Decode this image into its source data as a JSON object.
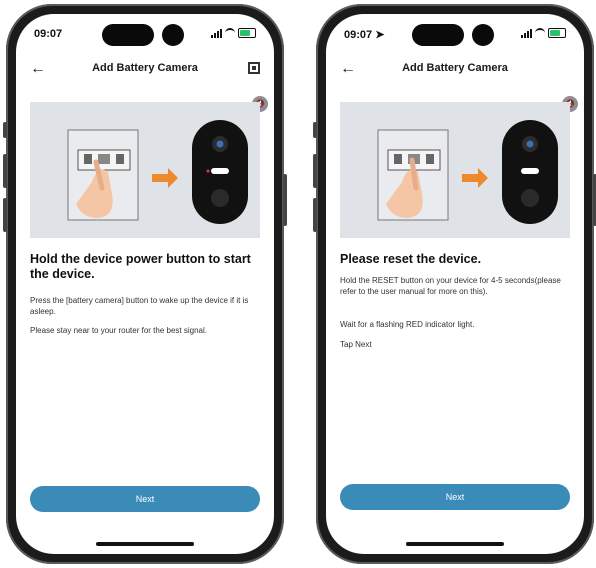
{
  "phones": [
    {
      "status_time": "09:07",
      "nav_title": "Add Battery Camera",
      "heading": "Hold the device power button to start the device.",
      "paragraphs": [
        "Press the [battery camera] button to wake up the device if it is asleep.",
        "Please stay near to your router for the best signal."
      ],
      "next_label": "Next"
    },
    {
      "status_time": "09:07",
      "nav_title": "Add Battery Camera",
      "heading": "Please reset the device.",
      "paragraphs": [
        "Hold the RESET button on your device for 4-5 seconds(please refer to the user manual for more on this).",
        "Wait for a flashing RED indicator light.",
        "Tap Next"
      ],
      "next_label": "Next"
    }
  ],
  "colors": {
    "accent": "#3a8bb8",
    "arrow": "#f0892d",
    "battery": "#29c26b"
  },
  "icons": [
    "back-arrow-icon",
    "qr-code-icon",
    "mute-icon",
    "signal-icon",
    "wifi-icon",
    "battery-icon",
    "location-arrow-icon"
  ]
}
